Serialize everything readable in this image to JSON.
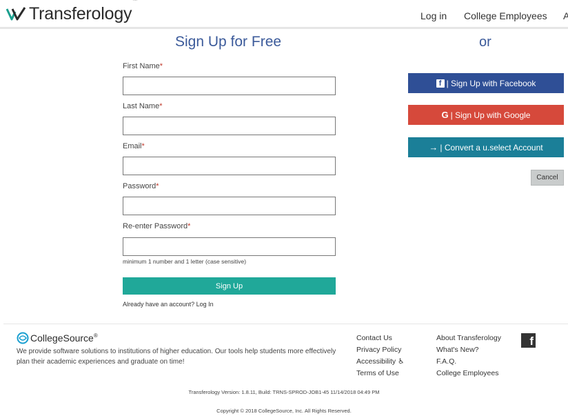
{
  "header": {
    "logo_text": "Transferology",
    "logo_tm": "™",
    "nav": [
      "Log in",
      "College Employees",
      "A"
    ]
  },
  "form": {
    "title": "Sign Up for Free",
    "fields": [
      {
        "label": "First Name",
        "required": "*",
        "value": ""
      },
      {
        "label": "Last Name",
        "required": "*",
        "value": ""
      },
      {
        "label": "Email",
        "required": "*",
        "value": ""
      },
      {
        "label": "Password",
        "required": "*",
        "value": ""
      },
      {
        "label": "Re-enter Password",
        "required": "*",
        "value": ""
      }
    ],
    "hint": "minimum 1 number and 1 letter (case sensitive)",
    "signup_label": "Sign Up",
    "already_text": "Already have an account? Log In"
  },
  "social": {
    "or_text": "or",
    "facebook_label": "| Sign Up with Facebook",
    "facebook_glyph": "f",
    "google_label": "| Sign Up with Google",
    "google_glyph": "G",
    "uselect_label": "| Convert a u.select Account",
    "uselect_glyph": "→",
    "cancel_label": "Cancel",
    "colors": {
      "facebook": "#2f4f96",
      "google": "#d6493b",
      "uselect": "#1b7f98"
    }
  },
  "footer": {
    "brand": "CollegeSource",
    "brand_reg": "®",
    "description": "We provide software solutions to institutions of higher education. Our tools help students more effectively plan their academic experiences and graduate on time!",
    "col1": [
      "Contact Us",
      "Privacy Policy",
      "Accessibility",
      "Terms of Use"
    ],
    "col2": [
      "About Transferology",
      "What's New?",
      "F.A.Q.",
      "College Employees"
    ],
    "facebook_glyph": "f",
    "version": "Transferology Version: 1.8.11, Build: TRNS-SPROD-JOB1-45 11/14/2018 04:49 PM",
    "copyright": "Copyright © 2018 CollegeSource, Inc. All Rights Reserved."
  },
  "colors": {
    "accent": "#20a899",
    "title": "#3b5a9a"
  }
}
